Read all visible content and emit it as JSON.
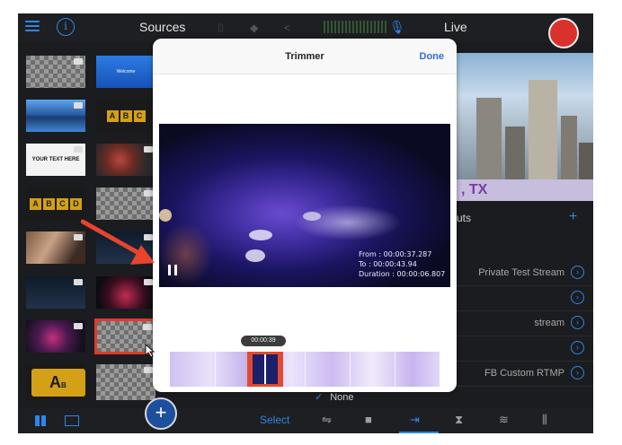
{
  "topbar": {
    "sources_title": "Sources",
    "info_glyph": "i",
    "live_title": "Live",
    "camera_icon": "⌷",
    "dropbox_icon": "◆",
    "share_icon": "<",
    "mic_icon": "🎙"
  },
  "thumbnails": {
    "welcome_text": "Welcome",
    "abc_letters": [
      "A",
      "B",
      "C"
    ],
    "abcd_letters": [
      "A",
      "B",
      "C",
      "D"
    ],
    "your_text": "YOUR TEXT HERE",
    "big_letter": "A",
    "big_letter_sub": "B"
  },
  "right_panel": {
    "city_caption": ", TX",
    "outputs_label": "uts",
    "rows": [
      {
        "label": "Private Test Stream"
      },
      {
        "label": ""
      },
      {
        "label": "stream"
      },
      {
        "label": ""
      },
      {
        "label": "FB Custom RTMP"
      }
    ],
    "none_check": "✓",
    "none_label": "None"
  },
  "trimmer": {
    "title": "Trimmer",
    "done_label": "Done",
    "from_text": "From : 00:00:37.287",
    "to_text": "To : 00:00:43.94",
    "duration_text": "Duration : 00:00:06.807",
    "scrub_time": "00:00:39"
  },
  "bottombar": {
    "add_glyph": "+",
    "select_label": "Select",
    "sliders_icon": "⇋",
    "camera_icon": "■",
    "output_icon": "⇥",
    "transition_icon": "⧗",
    "audio_icon": "≋",
    "levels_icon": "⫼"
  },
  "colors": {
    "accent": "#2f86e8",
    "record": "#d9312b",
    "trim_handle": "#e24a2f",
    "annotation_arrow": "#e8442e"
  }
}
